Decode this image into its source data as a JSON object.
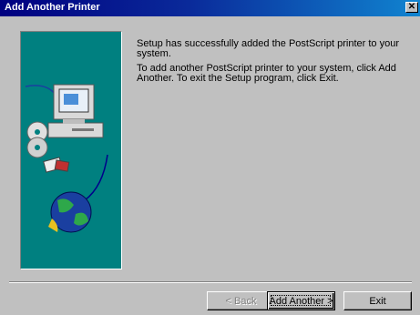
{
  "window": {
    "title": "Add Another Printer",
    "close_glyph": "✕"
  },
  "message": {
    "line1": "Setup has successfully added the PostScript printer to your system.",
    "line2": "To add another PostScript printer to your system, click Add Another. To exit the Setup program, click Exit."
  },
  "buttons": {
    "back": "< Back",
    "add_another": "Add Another >",
    "exit": "Exit"
  },
  "illustration": {
    "background": "#008080",
    "icons": [
      "computer-icon",
      "cd-icon",
      "floppy-icon",
      "globe-icon"
    ]
  }
}
